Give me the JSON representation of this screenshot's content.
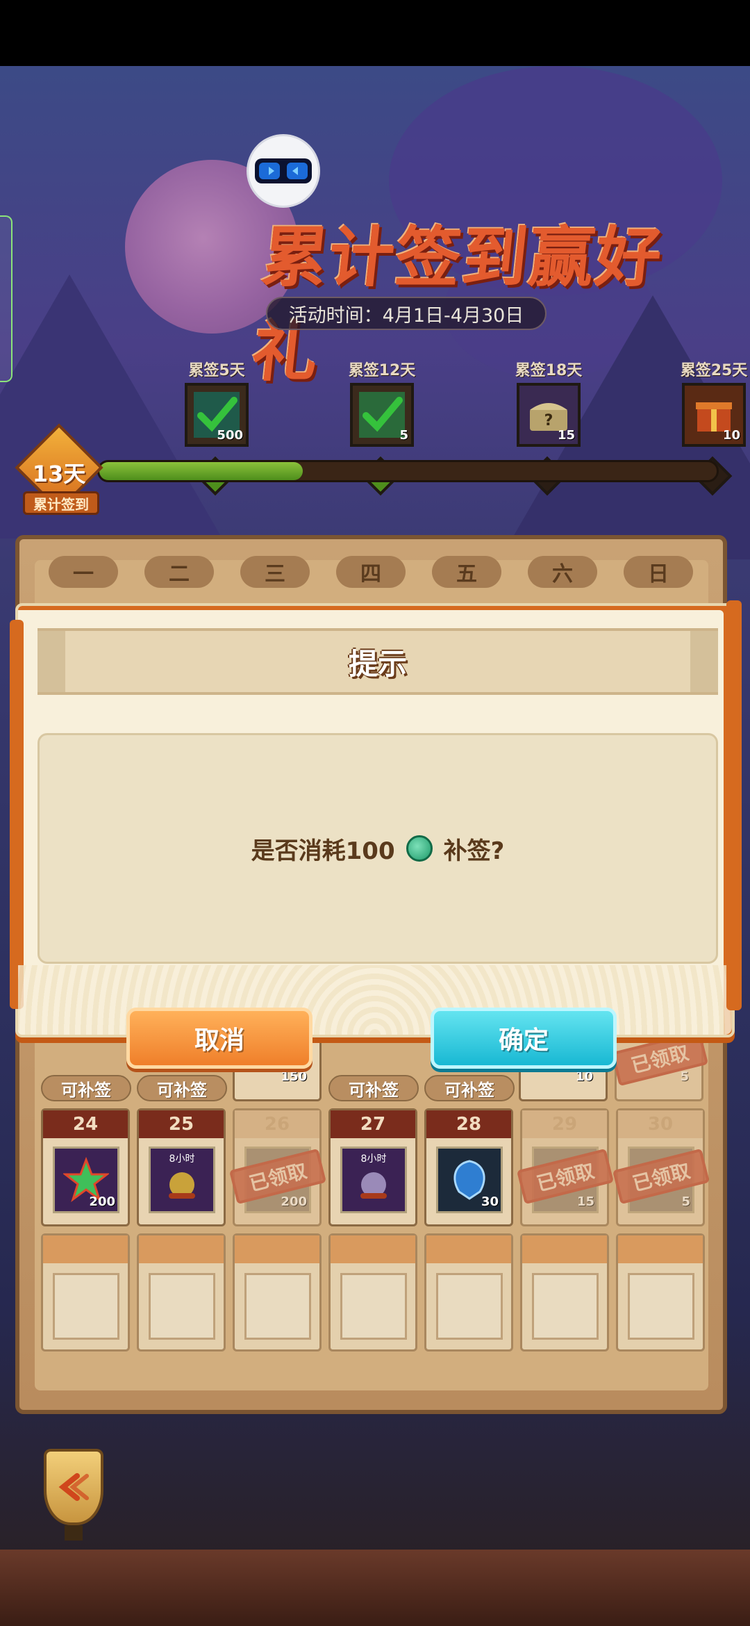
{
  "event": {
    "title": "累计签到赢好礼",
    "date_range": "活动时间：4月1日-4月30日"
  },
  "milestones": [
    {
      "label": "累签5天",
      "count": "500",
      "icon": "check-icon",
      "reached": true
    },
    {
      "label": "累签12天",
      "count": "5",
      "icon": "check-icon",
      "reached": true
    },
    {
      "label": "累签18天",
      "count": "15",
      "icon": "mystery-chest-icon",
      "reached": false
    },
    {
      "label": "累签25天",
      "count": "10",
      "icon": "gift-box-icon",
      "reached": false
    }
  ],
  "progress": {
    "days": "13天",
    "label": "累计签到",
    "fraction": 0.33
  },
  "weekdays": [
    "一",
    "二",
    "三",
    "四",
    "五",
    "六",
    "日"
  ],
  "calendar": {
    "row_prev": [
      {
        "qty": "150",
        "makeup": ""
      },
      {
        "qty": "10",
        "makeup": ""
      },
      {
        "qty": "5",
        "stamp": "已领取"
      }
    ],
    "makeup_tags": [
      "可补签",
      "可补签",
      "可补签",
      "可补签"
    ],
    "row_last": [
      {
        "day": "24",
        "qty": "200",
        "icon": "star-icon"
      },
      {
        "day": "25",
        "qty": "",
        "icon": "cat-fortune-icon",
        "tag": "8小时"
      },
      {
        "day": "26",
        "qty": "200",
        "icon": "star-icon",
        "stamp": "已领取"
      },
      {
        "day": "27",
        "qty": "",
        "icon": "cat-fortune-icon",
        "tag": "8小时"
      },
      {
        "day": "28",
        "qty": "30",
        "icon": "blue-gem-icon"
      },
      {
        "day": "29",
        "qty": "15",
        "icon": "chest-icon",
        "stamp": "已领取"
      },
      {
        "day": "30",
        "qty": "5",
        "icon": "item-icon",
        "stamp": "已领取"
      }
    ]
  },
  "dialog": {
    "title": "提示",
    "message_prefix": "是否消耗100",
    "message_suffix": "补签?",
    "cancel": "取消",
    "confirm": "确定"
  },
  "colors": {
    "cancel": "#ef7f2a",
    "confirm": "#18b8d3",
    "progress_fill": "#4e8e1c"
  }
}
